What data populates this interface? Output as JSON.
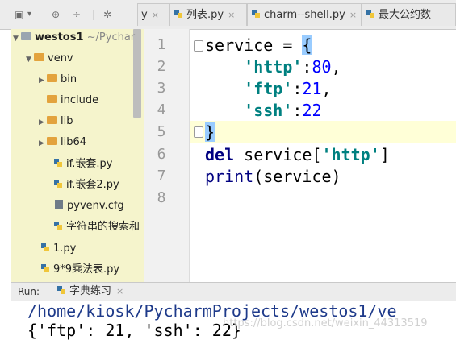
{
  "tabs": [
    {
      "name": "tab-partial",
      "label": "y",
      "closable": true
    },
    {
      "name": "tab-list",
      "label": "列表.py",
      "closable": true
    },
    {
      "name": "tab-charm-shell",
      "label": "charm--shell.py",
      "closable": true
    },
    {
      "name": "tab-gcd",
      "label": "最大公约数",
      "closable": false
    }
  ],
  "project": {
    "root_name": "westos1",
    "root_path": "~/Pychar",
    "items": [
      {
        "name": "venv",
        "indent": 1,
        "expanded": true,
        "kind": "folder"
      },
      {
        "name": "bin",
        "indent": 2,
        "expanded": false,
        "kind": "folder"
      },
      {
        "name": "include",
        "indent": 2,
        "expanded": null,
        "kind": "folder"
      },
      {
        "name": "lib",
        "indent": 2,
        "expanded": false,
        "kind": "folder"
      },
      {
        "name": "lib64",
        "indent": 2,
        "expanded": false,
        "kind": "folder"
      },
      {
        "name": "if.嵌套.py",
        "indent": 2,
        "kind": "py"
      },
      {
        "name": "if.嵌套2.py",
        "indent": 2,
        "kind": "py"
      },
      {
        "name": "pyvenv.cfg",
        "indent": 2,
        "kind": "cfg"
      },
      {
        "name": "字符串的搜索和",
        "indent": 2,
        "kind": "py"
      },
      {
        "name": "1.py",
        "indent": 1,
        "kind": "py"
      },
      {
        "name": "9*9乘法表.py",
        "indent": 1,
        "kind": "py"
      }
    ]
  },
  "editor": {
    "line_numbers": [
      "1",
      "2",
      "3",
      "4",
      "5",
      "6",
      "7",
      "8"
    ],
    "code": {
      "l1_var": "service",
      "l1_op": " = ",
      "l1_brace": "{",
      "l2_key": "'http'",
      "l2_val": "80",
      "l3_key": "'ftp'",
      "l3_val": "21",
      "l4_key": "'ssh'",
      "l4_val": "22",
      "l5_brace": "}",
      "l6_kw": "del",
      "l6_rest": " service[",
      "l6_str": "'http'",
      "l6_end": "]",
      "l7_fn": "print",
      "l7_rest": "(service)"
    }
  },
  "run": {
    "label": "Run:",
    "tab": "字典练习",
    "output_path": "/home/kiosk/PycharmProjects/westos1/ve",
    "output_result": "{'ftp': 21, 'ssh': 22}",
    "watermark": "https://blog.csdn.net/weixin_44313519"
  },
  "colors": {
    "keyword": "#000080",
    "string": "#008080",
    "number": "#0000ff",
    "project_bg": "#f5f4cc"
  }
}
